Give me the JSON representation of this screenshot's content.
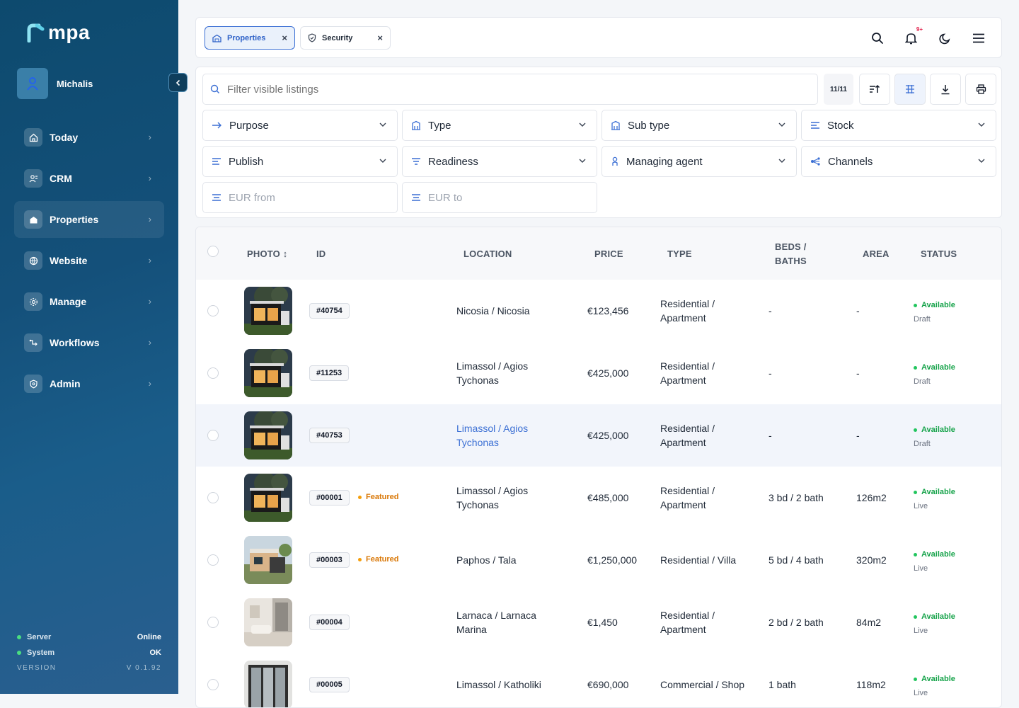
{
  "app": {
    "logo_text": "mpa"
  },
  "user": {
    "name": "Michalis"
  },
  "sidebar": {
    "items": [
      {
        "label": "Today",
        "icon": "home-icon"
      },
      {
        "label": "CRM",
        "icon": "users-icon"
      },
      {
        "label": "Properties",
        "icon": "building-icon",
        "active": true
      },
      {
        "label": "Website",
        "icon": "globe-icon"
      },
      {
        "label": "Manage",
        "icon": "gear-icon"
      },
      {
        "label": "Workflows",
        "icon": "workflow-icon"
      },
      {
        "label": "Admin",
        "icon": "shield-icon"
      }
    ],
    "status": {
      "server_label": "Server",
      "server_value": "Online",
      "system_label": "System",
      "system_value": "OK",
      "version_label": "VERSION",
      "version_value": "V 0.1.92"
    }
  },
  "tabs": [
    {
      "label": "Properties",
      "active": true
    },
    {
      "label": "Security",
      "active": false
    }
  ],
  "notifications": {
    "badge": "9+"
  },
  "filters": {
    "search_placeholder": "Filter visible listings",
    "count": "11/11",
    "row1": [
      "Purpose",
      "Type",
      "Sub type",
      "Stock"
    ],
    "row2": [
      "Publish",
      "Readiness",
      "Managing agent",
      "Channels"
    ],
    "eur_from_placeholder": "EUR from",
    "eur_to_placeholder": "EUR to"
  },
  "table": {
    "headers": {
      "photo": "PHOTO ↕",
      "id": "ID",
      "location": "LOCATION",
      "price": "PRICE",
      "type": "TYPE",
      "beds_1": "BEDS /",
      "beds_2": "BATHS",
      "area": "AREA",
      "status": "STATUS"
    },
    "rows": [
      {
        "id": "#40754",
        "featured": "",
        "loc1": "Nicosia / Nicosia",
        "loc2": "",
        "price": "€123,456",
        "type1": "Residential /",
        "type2": "Apartment",
        "beds": "-",
        "area": "-",
        "status": "Available",
        "sub": "Draft",
        "photo": "modern-house"
      },
      {
        "id": "#11253",
        "featured": "",
        "loc1": "Limassol / Agios",
        "loc2": "Tychonas",
        "price": "€425,000",
        "type1": "Residential /",
        "type2": "Apartment",
        "beds": "-",
        "area": "-",
        "status": "Available",
        "sub": "Draft",
        "photo": "modern-house"
      },
      {
        "id": "#40753",
        "featured": "",
        "loc1": "Limassol / Agios",
        "loc2": "Tychonas",
        "price": "€425,000",
        "type1": "Residential /",
        "type2": "Apartment",
        "beds": "-",
        "area": "-",
        "status": "Available",
        "sub": "Draft",
        "photo": "modern-house"
      },
      {
        "id": "#00001",
        "featured": "Featured",
        "loc1": "Limassol / Agios",
        "loc2": "Tychonas",
        "price": "€485,000",
        "type1": "Residential /",
        "type2": "Apartment",
        "beds": "3 bd / 2 bath",
        "area": "126m2",
        "status": "Available",
        "sub": "Live",
        "photo": "modern-house"
      },
      {
        "id": "#00003",
        "featured": "Featured",
        "loc1": "Paphos / Tala",
        "loc2": "",
        "price": "€1,250,000",
        "type1": "Residential / Villa",
        "type2": "",
        "beds": "5 bd / 4 bath",
        "area": "320m2",
        "status": "Available",
        "sub": "Live",
        "photo": "villa"
      },
      {
        "id": "#00004",
        "featured": "",
        "loc1": "Larnaca / Larnaca",
        "loc2": "Marina",
        "price": "€1,450",
        "type1": "Residential /",
        "type2": "Apartment",
        "beds": "2 bd / 2 bath",
        "area": "84m2",
        "status": "Available",
        "sub": "Live",
        "photo": "interior"
      },
      {
        "id": "#00005",
        "featured": "",
        "loc1": "Limassol / Katholiki",
        "loc2": "",
        "price": "€690,000",
        "type1": "Commercial / Shop",
        "type2": "",
        "beds": "1 bath",
        "area": "118m2",
        "status": "Available",
        "sub": "Live",
        "photo": "shop"
      }
    ]
  }
}
